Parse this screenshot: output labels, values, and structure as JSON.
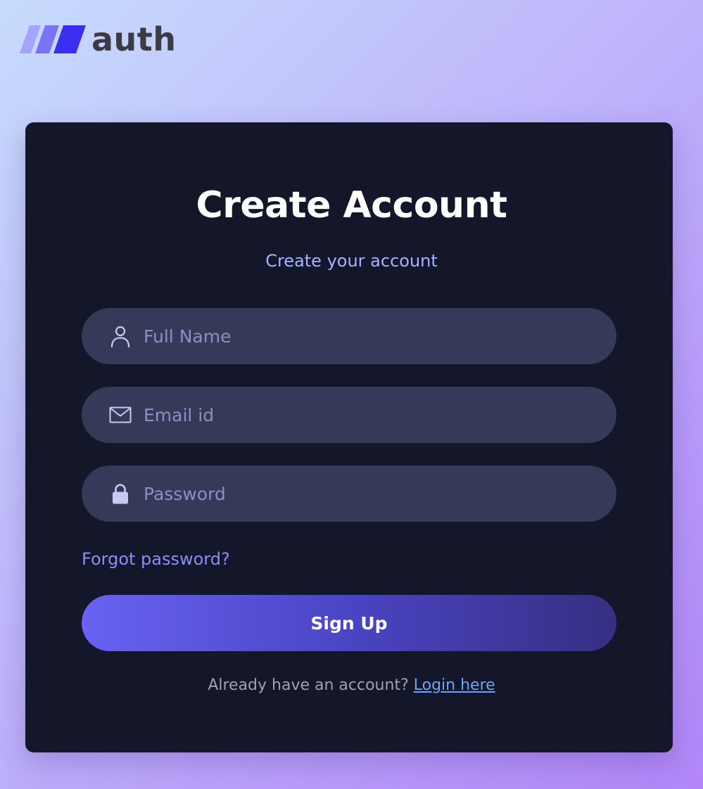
{
  "brand": {
    "name": "auth",
    "colors": {
      "mark_light": "#a5a3fb",
      "mark_mid": "#7b73f6",
      "mark_dark": "#3c2ef0",
      "text": "#3b3a45"
    }
  },
  "card": {
    "title": "Create Account",
    "subtitle": "Create your account",
    "background": "#131729"
  },
  "form": {
    "fields": {
      "full_name": {
        "icon": "person-icon",
        "placeholder": "Full Name",
        "value": ""
      },
      "email": {
        "icon": "mail-icon",
        "placeholder": "Email id",
        "value": ""
      },
      "password": {
        "icon": "lock-icon",
        "placeholder": "Password",
        "value": ""
      }
    },
    "forgot_password_label": "Forgot password?",
    "submit_label": "Sign Up",
    "submit_gradient": [
      "#6962f2",
      "#362f82"
    ]
  },
  "footer": {
    "prompt": "Already have an account?",
    "login_link_label": "Login here",
    "link_color": "#6ea4f5"
  }
}
